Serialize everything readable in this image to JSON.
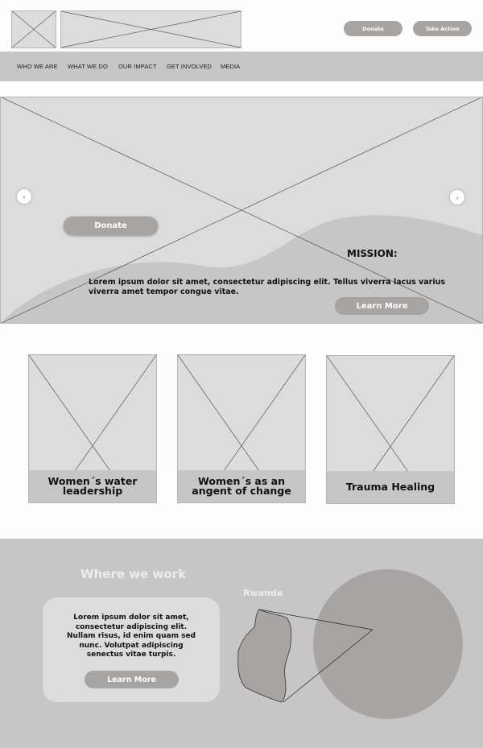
{
  "header": {
    "logo": "logo-placeholder",
    "banner": "banner-placeholder",
    "donate_label": "Donate",
    "take_action_label": "Take Action",
    "button_color": "#a8a4a4"
  },
  "nav": {
    "items": [
      {
        "label": "WHO WE ARE"
      },
      {
        "label": "WHAT WE DO"
      },
      {
        "label": "OUR IMPACT"
      },
      {
        "label": "GET INVOLVED"
      },
      {
        "label": "MEDIA"
      }
    ]
  },
  "hero": {
    "prev_icon": "chevron-left-icon",
    "next_icon": "chevron-right-icon",
    "prev_glyph": "‹",
    "next_glyph": "›",
    "donate_label": "Donate",
    "mission_title": "MISSION:",
    "mission_text": "Lorem ipsum dolor sit amet, consectetur adipiscing elit. Tellus viverra lacus varius viverra amet tempor congue vitae.",
    "learn_more_label": "Learn More"
  },
  "cards": [
    {
      "title": "Women´s water leadership"
    },
    {
      "title": "Women´s as an angent of change"
    },
    {
      "title": "Trauma Healing"
    }
  ],
  "where": {
    "title": "Where we work",
    "country": "Rwanda",
    "text": "Lorem ipsum dolor sit amet, consectetur adipiscing elit. Nullam risus, id enim quam sed nunc. Volutpat adipiscing senectus vitae turpis.",
    "learn_more_label": "Learn More"
  }
}
